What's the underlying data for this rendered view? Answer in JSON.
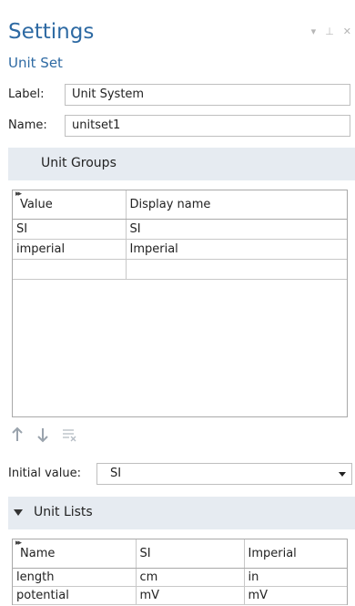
{
  "header": {
    "title": "Settings",
    "subtitle": "Unit Set"
  },
  "window_controls": {
    "menu": "▾",
    "pin": "⊥",
    "close": "✕"
  },
  "fields": {
    "label": {
      "label": "Label:",
      "value": "Unit System"
    },
    "name": {
      "label": "Name:",
      "value": "unitset1"
    }
  },
  "unit_groups": {
    "heading": "Unit Groups",
    "columns": [
      "Value",
      "Display name"
    ],
    "rows": [
      [
        "SI",
        "SI"
      ],
      [
        "imperial",
        "Imperial"
      ],
      [
        "",
        ""
      ]
    ]
  },
  "initial_value": {
    "label": "Initial value:",
    "selected": "SI"
  },
  "unit_lists": {
    "heading": "Unit Lists",
    "columns": [
      "Name",
      "SI",
      "Imperial"
    ],
    "rows": [
      [
        "length",
        "cm",
        "in"
      ],
      [
        "potential",
        "mV",
        "mV"
      ]
    ]
  },
  "colors": {
    "accent": "#2e6aa3",
    "section_bg": "#e6ebf1"
  }
}
